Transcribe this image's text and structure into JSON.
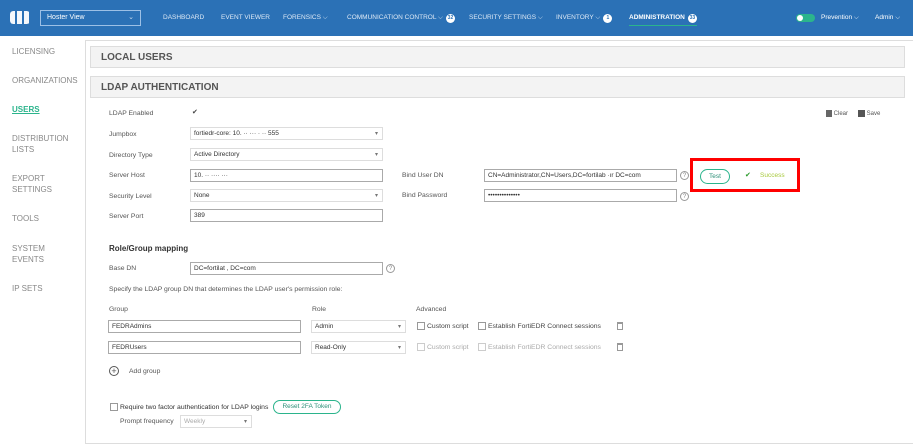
{
  "topbar": {
    "view_select": "Hoster View",
    "nav": [
      {
        "label": "DASHBOARD"
      },
      {
        "label": "EVENT VIEWER"
      },
      {
        "label": "FORENSICS"
      },
      {
        "label": "COMMUNICATION CONTROL",
        "badge": "32"
      },
      {
        "label": "SECURITY SETTINGS"
      },
      {
        "label": "INVENTORY",
        "badge": "1"
      },
      {
        "label": "ADMINISTRATION",
        "badge": "33",
        "active": true
      }
    ],
    "mode": "Prevention",
    "mode_enabled": true,
    "user": "Admin"
  },
  "sidebar": {
    "items": [
      "LICENSING",
      "ORGANIZATIONS",
      "USERS",
      "DISTRIBUTION LISTS",
      "EXPORT SETTINGS",
      "TOOLS",
      "SYSTEM EVENTS",
      "IP SETS"
    ],
    "active": "USERS"
  },
  "panels": {
    "local_users": "LOCAL USERS",
    "ldap": "LDAP AUTHENTICATION"
  },
  "actions": {
    "clear": "Clear",
    "save": "Save"
  },
  "form": {
    "ldap_enabled_label": "LDAP Enabled",
    "ldap_enabled": "✔",
    "jumpbox_label": "Jumpbox",
    "jumpbox": "fortiedr-core: 10. ·· ··· · ·· 555",
    "directory_type_label": "Directory Type",
    "directory_type": "Active Directory",
    "server_host_label": "Server Host",
    "server_host": "10. ·· ···· ···",
    "security_level_label": "Security Level",
    "security_level": "None",
    "server_port_label": "Server Port",
    "server_port": "389",
    "bind_user_dn_label": "Bind User DN",
    "bind_user_dn": "CN=Administrator,CN=Users,DC=fortilab ·ır DC=com",
    "bind_password_label": "Bind Password",
    "bind_password": "••••••••••••••",
    "test_button": "Test",
    "test_result": "Success"
  },
  "mapping": {
    "title": "Role/Group mapping",
    "base_dn_label": "Base DN",
    "base_dn": "DC=fortilat ,    DC=com",
    "instructions": "Specify the LDAP group DN that determines the LDAP user's permission role:",
    "col_group": "Group",
    "col_role": "Role",
    "col_advanced": "Advanced",
    "rows": [
      {
        "group": "FEDRAdmins",
        "role": "Admin",
        "custom_script": "Custom script",
        "connect": "Establish FortiEDR Connect sessions",
        "enabled": true
      },
      {
        "group": "FEDRUsers",
        "role": "Read-Only",
        "custom_script": "Custom script",
        "connect": "Establish FortiEDR Connect sessions",
        "enabled": false
      }
    ],
    "add_group": "Add group"
  },
  "twofa": {
    "label": "Require two factor authentication for LDAP logins",
    "reset_button": "Reset 2FA Token",
    "frequency_label": "Prompt frequency",
    "frequency": "Weekly"
  },
  "colors": {
    "topbar": "#2b71b6",
    "accent": "#2bb48c",
    "success": "#a8c93c",
    "highlight": "#ff0000"
  }
}
